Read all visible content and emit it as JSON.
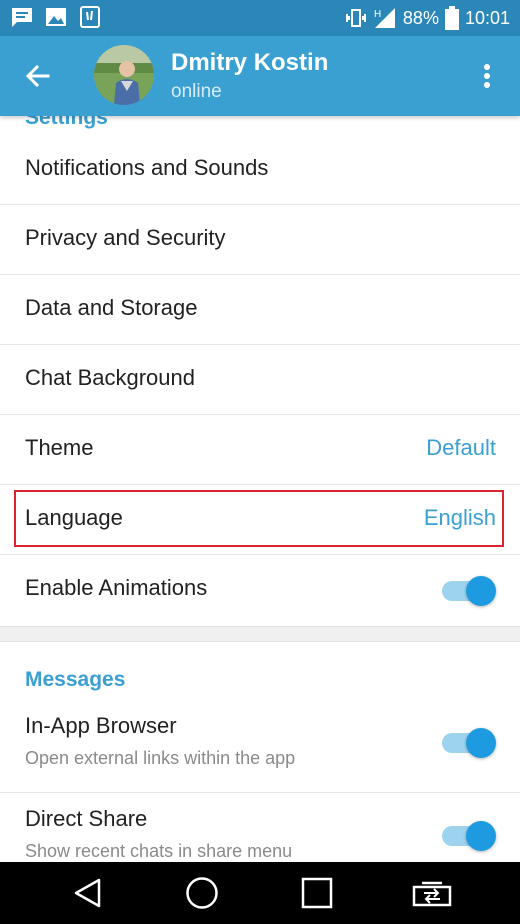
{
  "status_bar": {
    "battery_percent": "88%",
    "time": "10:01",
    "signal_badge": "H"
  },
  "app_bar": {
    "user_name": "Dmitry Kostin",
    "user_status": "online"
  },
  "settings": {
    "section_title": "Settings",
    "items": [
      {
        "label": "Notifications and Sounds"
      },
      {
        "label": "Privacy and Security"
      },
      {
        "label": "Data and Storage"
      },
      {
        "label": "Chat Background"
      },
      {
        "label": "Theme",
        "value": "Default"
      },
      {
        "label": "Language",
        "value": "English"
      },
      {
        "label": "Enable Animations",
        "toggle_on": true
      }
    ]
  },
  "messages": {
    "section_title": "Messages",
    "items": [
      {
        "label": "In-App Browser",
        "sublabel": "Open external links within the app",
        "toggle_on": true
      },
      {
        "label": "Direct Share",
        "sublabel": "Show recent chats in share menu",
        "toggle_on": true
      }
    ]
  },
  "colors": {
    "status_bar": "#2b87b8",
    "app_bar": "#3a9fd1",
    "accent": "#3a9fd1",
    "highlight": "#d9232e"
  },
  "icons": {
    "status_left": [
      "message-icon",
      "image-icon",
      "phone-icon"
    ],
    "status_right": [
      "vibrate-icon",
      "signal-icon",
      "battery-icon"
    ],
    "nav": [
      "back-triangle-icon",
      "home-circle-icon",
      "recents-square-icon",
      "switch-app-icon"
    ]
  }
}
